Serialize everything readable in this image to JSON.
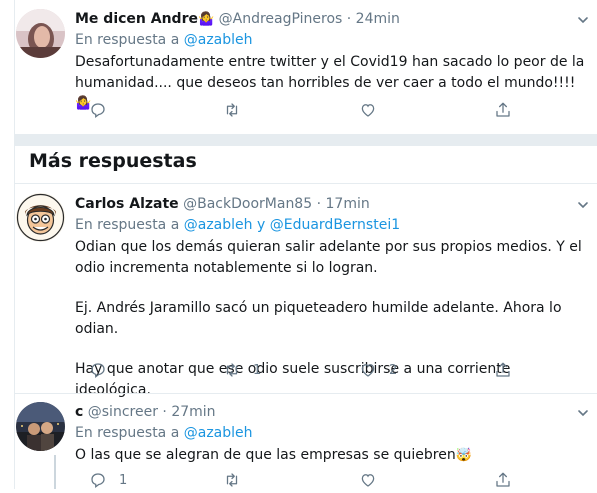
{
  "tweets": [
    {
      "name": "Me dicen Andre",
      "name_emoji": "🤷‍♀️",
      "handle": "@AndreagPineros",
      "dot": "·",
      "time": "24min",
      "reply_prefix": "En respuesta a",
      "reply_to": "@azableh",
      "text_lines": [
        "Desafortunadamente entre twitter y el Covid19 han sacado lo peor de la humanidad.... que deseos tan horribles de ver caer a todo el mundo!!!!"
      ],
      "text_emoji": "🤷‍♀️",
      "counts": {
        "reply": "",
        "retweet": "",
        "like": ""
      }
    },
    {
      "name": "Carlos Alzate",
      "handle": "@BackDoorMan85",
      "dot": "·",
      "time": "17min",
      "reply_prefix": "En respuesta a",
      "reply_to": "@azableh",
      "reply_and": "y",
      "reply_to_2": "@EduardBernstei1",
      "paragraphs": [
        "Odian que los demás quieran salir adelante por sus propios medios. Y el odio incrementa notablemente si lo logran.",
        "Ej. Andrés Jaramillo sacó un piqueteadero humilde adelante. Ahora lo odian.",
        "Hay que anotar que ese odio suele suscribirse a una corriente ideológica."
      ],
      "counts": {
        "reply": "",
        "retweet": "1",
        "like": "2"
      }
    },
    {
      "name": "c",
      "handle": "@sincreer",
      "dot": "·",
      "time": "27min",
      "reply_prefix": "En respuesta a",
      "reply_to": "@azableh",
      "text": "O las que se alegran de que las empresas se quiebren",
      "text_emoji": "🤯",
      "counts": {
        "reply": "1",
        "retweet": "",
        "like": ""
      }
    }
  ],
  "section": {
    "title": "Más respuestas"
  },
  "icons": {
    "reply": "reply-icon",
    "retweet": "retweet-icon",
    "like": "heart-icon",
    "share": "share-icon",
    "more": "chevron-down-icon"
  },
  "colors": {
    "link": "#1b95e0",
    "muted": "#657786",
    "separator": "#e6ecf0"
  }
}
